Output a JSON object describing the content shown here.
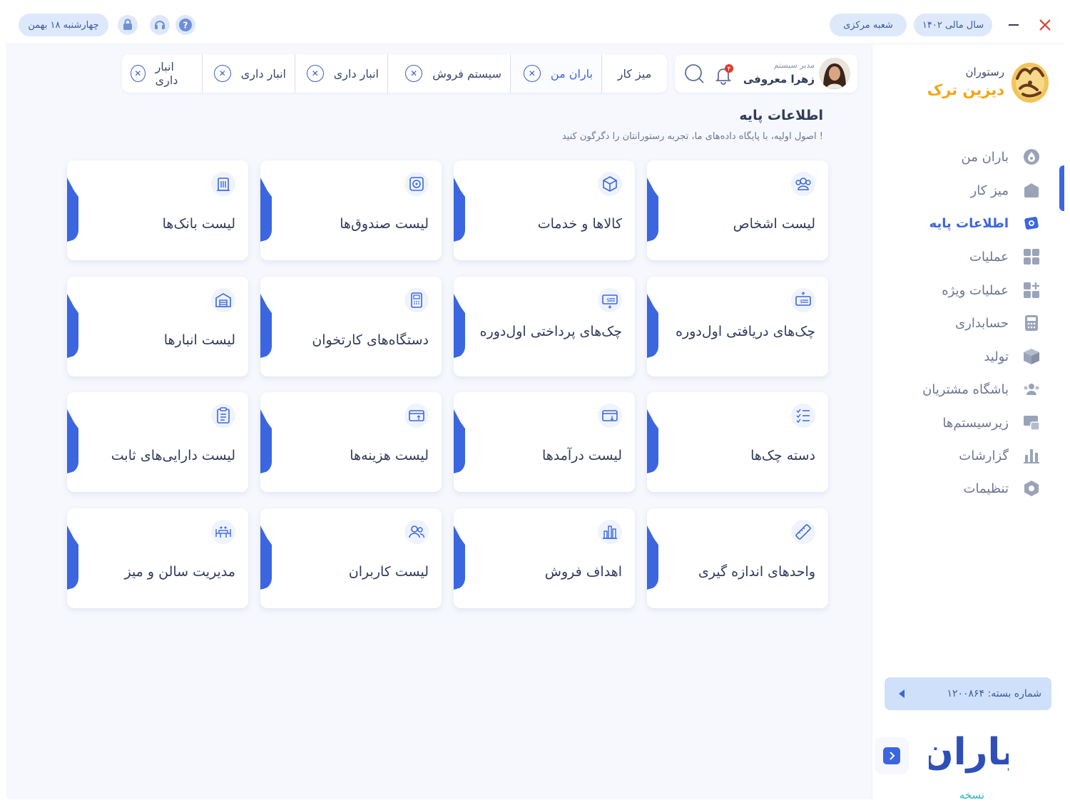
{
  "titlebar": {
    "date": "چهارشنبه ۱۸ بهمن",
    "fiscal_year": "سال مالی ۱۴۰۲",
    "branch": "شعبه مرکزی"
  },
  "brand": {
    "subtitle": "رستوران",
    "name": "دیزین ترک"
  },
  "user": {
    "role": "مدیر سیستم",
    "name": "زهرا معروفی",
    "notifications": "۴"
  },
  "tabs": [
    {
      "label": "میز کار",
      "closable": false
    },
    {
      "label": "باران من",
      "closable": true,
      "active": true
    },
    {
      "label": "سیستم فروش",
      "closable": true
    },
    {
      "label": "انبار داری",
      "closable": true
    },
    {
      "label": "انبار داری",
      "closable": true
    },
    {
      "label": "انبار داری",
      "closable": true
    }
  ],
  "page": {
    "title": "اطلاعات پایه",
    "subtitle": "اصول اولیه، با پایگاه داده‌های ما، تجربه رستورانتان را دگرگون کنید !"
  },
  "nav": [
    {
      "label": "باران من",
      "icon": "baran-icon"
    },
    {
      "label": "میز کار",
      "icon": "desk-icon"
    },
    {
      "label": "اطلاعات پایه",
      "icon": "database-icon",
      "active": true
    },
    {
      "label": "عملیات",
      "icon": "grid-icon"
    },
    {
      "label": "عملیات ویژه",
      "icon": "grid-plus-icon"
    },
    {
      "label": "حسابداری",
      "icon": "calculator-icon"
    },
    {
      "label": "تولید",
      "icon": "box-icon"
    },
    {
      "label": "باشگاه مشتریان",
      "icon": "users-icon"
    },
    {
      "label": "زیرسیستم‌ها",
      "icon": "subsystem-icon"
    },
    {
      "label": "گزارشات",
      "icon": "chart-icon"
    },
    {
      "label": "تنظیمات",
      "icon": "settings-icon"
    }
  ],
  "cards": [
    {
      "title": "لیست اشخاص",
      "icon": "people-icon"
    },
    {
      "title": "کالاها و خدمات",
      "icon": "package-icon"
    },
    {
      "title": "لیست صندوق‌ها",
      "icon": "safe-icon"
    },
    {
      "title": "لیست بانک‌ها",
      "icon": "bank-icon"
    },
    {
      "title": "چک‌های دریافتی اول‌دوره",
      "icon": "cheque-in-icon"
    },
    {
      "title": "چک‌های پرداختی اول‌دوره",
      "icon": "cheque-out-icon"
    },
    {
      "title": "دستگاه‌های کارتخوان",
      "icon": "pos-icon"
    },
    {
      "title": "لیست انبارها",
      "icon": "warehouse-icon"
    },
    {
      "title": "دسته چک‌ها",
      "icon": "checklist-icon"
    },
    {
      "title": "لیست درآمدها",
      "icon": "income-icon"
    },
    {
      "title": "لیست هزینه‌ها",
      "icon": "expense-icon"
    },
    {
      "title": "لیست دارایی‌های ثابت",
      "icon": "clipboard-icon"
    },
    {
      "title": "واحدهای اندازه گیری",
      "icon": "ruler-icon"
    },
    {
      "title": "اهداف فروش",
      "icon": "target-chart-icon"
    },
    {
      "title": "لیست کاربران",
      "icon": "user-group-icon"
    },
    {
      "title": "مدیریت سالن و میز",
      "icon": "table-icon"
    }
  ],
  "sidebar_footer": {
    "package_label": "شماره بسته: ۱۲۰۰۸۶۴",
    "logo_text": "باران",
    "version_label": "نسخه"
  },
  "colors": {
    "accent": "#3b66e0",
    "brand": "#f2a712",
    "pill": "#dde8fb",
    "close": "#e0392b"
  }
}
